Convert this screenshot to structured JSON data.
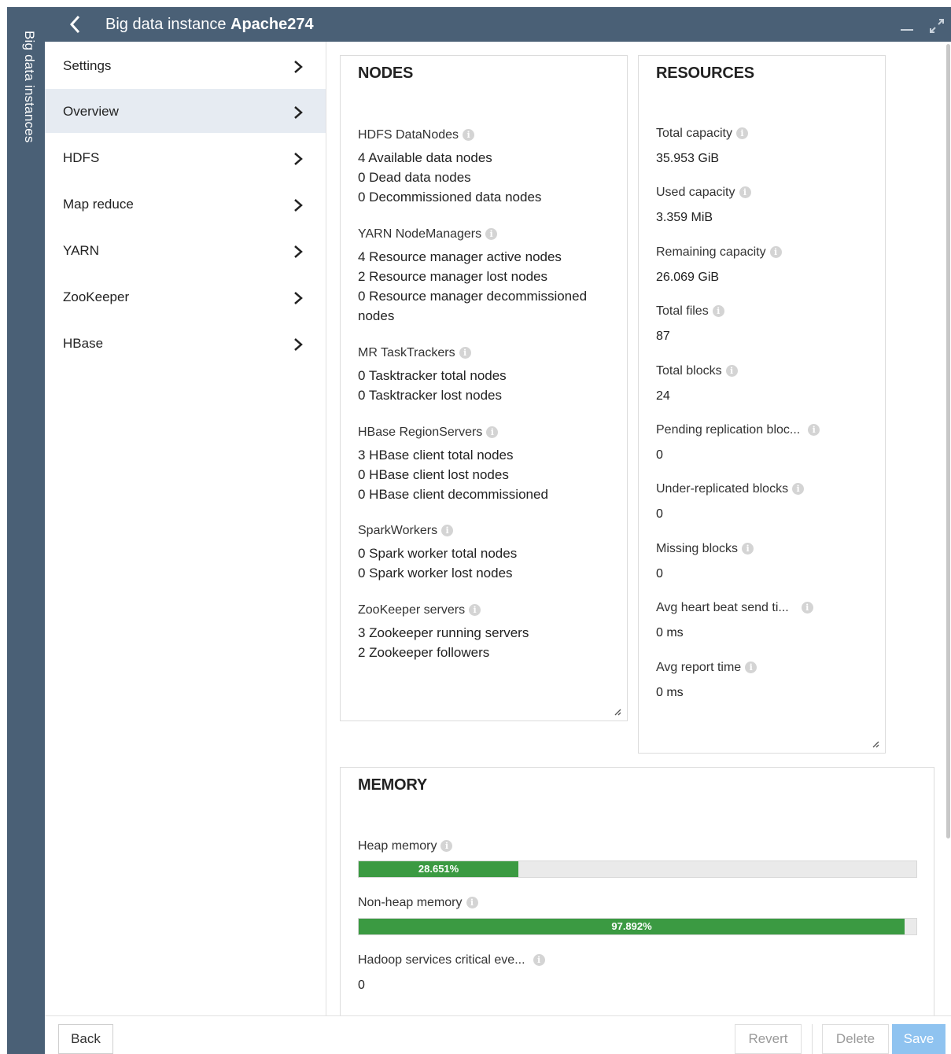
{
  "side_rail": {
    "label": "Big data instances"
  },
  "header": {
    "title_prefix": "Big data instance",
    "title_name": "Apache274"
  },
  "nav": {
    "items": [
      {
        "label": "Settings",
        "active": false
      },
      {
        "label": "Overview",
        "active": true
      },
      {
        "label": "HDFS",
        "active": false
      },
      {
        "label": "Map reduce",
        "active": false
      },
      {
        "label": "YARN",
        "active": false
      },
      {
        "label": "ZooKeeper",
        "active": false
      },
      {
        "label": "HBase",
        "active": false
      }
    ]
  },
  "nodes": {
    "title": "NODES",
    "groups": [
      {
        "label": "HDFS DataNodes",
        "lines": [
          "4 Available data nodes",
          "0 Dead data nodes",
          "0 Decommissioned data nodes"
        ]
      },
      {
        "label": "YARN NodeManagers",
        "lines": [
          "4 Resource manager active nodes",
          "2 Resource manager lost nodes",
          "0 Resource manager decommissioned nodes"
        ]
      },
      {
        "label": "MR TaskTrackers",
        "lines": [
          "0 Tasktracker total nodes",
          "0 Tasktracker lost nodes"
        ]
      },
      {
        "label": "HBase RegionServers",
        "lines": [
          "3 HBase client total nodes",
          "0 HBase client lost nodes",
          "0 HBase client decommissioned"
        ]
      },
      {
        "label": "SparkWorkers",
        "lines": [
          "0 Spark worker total nodes",
          "0 Spark worker lost nodes"
        ]
      },
      {
        "label": "ZooKeeper servers",
        "lines": [
          "3 Zookeeper running servers",
          "2 Zookeeper followers"
        ]
      }
    ]
  },
  "resources": {
    "title": "RESOURCES",
    "items": [
      {
        "label": "Total capacity",
        "value": "35.953 GiB"
      },
      {
        "label": "Used capacity",
        "value": "3.359 MiB"
      },
      {
        "label": "Remaining capacity",
        "value": "26.069 GiB"
      },
      {
        "label": "Total files",
        "value": "87"
      },
      {
        "label": "Total blocks",
        "value": "24"
      },
      {
        "label": "Pending replication bloc...",
        "value": "0"
      },
      {
        "label": "Under-replicated blocks",
        "value": "0"
      },
      {
        "label": "Missing blocks",
        "value": "0"
      },
      {
        "label": "Avg heart beat send ti...",
        "value": "0 ms"
      },
      {
        "label": "Avg report time",
        "value": "0 ms"
      }
    ]
  },
  "memory": {
    "title": "MEMORY",
    "heap": {
      "label": "Heap memory",
      "percent": 28.651,
      "text": "28.651%"
    },
    "nonheap": {
      "label": "Non-heap memory",
      "percent": 97.892,
      "text": "97.892%"
    },
    "critical": {
      "label": "Hadoop services critical eve...",
      "value": "0"
    }
  },
  "footer": {
    "back": "Back",
    "revert": "Revert",
    "delete": "Delete",
    "save": "Save"
  },
  "colors": {
    "chrome": "#4a6076",
    "bar_fill": "#3b9a42",
    "active_nav": "#e6ebf2",
    "save_button": "#8fc3f0"
  },
  "info_glyph": "i"
}
